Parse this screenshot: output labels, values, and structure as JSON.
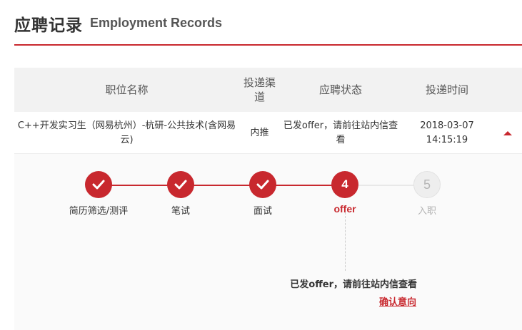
{
  "header": {
    "title_cn": "应聘记录",
    "title_en": "Employment Records"
  },
  "table": {
    "columns": [
      "职位名称",
      "投递渠道",
      "应聘状态",
      "投递时间"
    ],
    "rows": [
      {
        "position": "C++开发实习生（网易杭州）-杭研-公共技术(含网易云)",
        "channel": "内推",
        "status": "已发offer，请前往站内信查看",
        "time": "2018-03-07 14:15:19"
      }
    ]
  },
  "progress": {
    "steps": [
      {
        "number": "",
        "label": "简历筛选/测评",
        "state": "done",
        "icon": "check-icon"
      },
      {
        "number": "",
        "label": "笔试",
        "state": "done",
        "icon": "check-icon"
      },
      {
        "number": "",
        "label": "面试",
        "state": "done",
        "icon": "check-icon"
      },
      {
        "number": "4",
        "label": "offer",
        "state": "current"
      },
      {
        "number": "5",
        "label": "入职",
        "state": "todo"
      }
    ],
    "message": "已发offer，请前往站内信查看",
    "action_label": "确认意向"
  },
  "colors": {
    "accent": "#c8282e",
    "header_bg": "#f2f2f2",
    "pending": "#b5b5b5"
  }
}
